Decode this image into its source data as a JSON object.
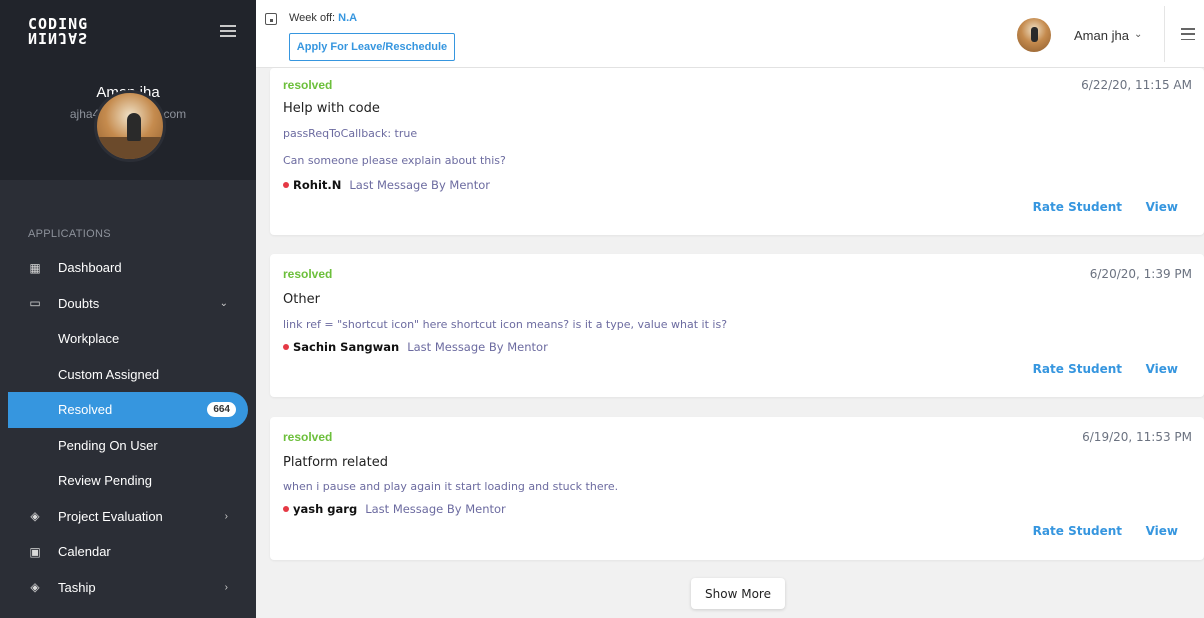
{
  "sidebar": {
    "logo_line1": "CODING",
    "logo_line2": "NINJAS",
    "user_name": "Aman jha",
    "user_email": "ajha4942@gmail.com",
    "section_label": "APPLICATIONS",
    "items": [
      {
        "label": "Dashboard",
        "icon": "dashboard-icon"
      },
      {
        "label": "Doubts",
        "icon": "doubts-icon"
      },
      {
        "label": "Workplace"
      },
      {
        "label": "Custom Assigned"
      },
      {
        "label": "Resolved",
        "badge": "664"
      },
      {
        "label": "Pending On User"
      },
      {
        "label": "Review Pending"
      },
      {
        "label": "Project Evaluation",
        "icon": "project-evaluation-icon"
      },
      {
        "label": "Calendar",
        "icon": "calendar-icon"
      },
      {
        "label": "Taship",
        "icon": "taship-icon"
      }
    ],
    "active_color": "#3696df"
  },
  "header": {
    "weekoff_label": "Week off:",
    "weekoff_value": "N.A",
    "leave_button": "Apply For Leave/Reschedule",
    "user_name": "Aman jha"
  },
  "cards": [
    {
      "status": "resolved",
      "time": "6/22/20, 11:15 AM",
      "title": "Help with code",
      "lines": [
        "passReqToCallback: true",
        "Can someone please explain about this?"
      ],
      "mentor": "Rohit.N",
      "last_message": "Last Message By Mentor",
      "rate": "Rate Student",
      "view": "View"
    },
    {
      "status": "resolved",
      "time": "6/20/20, 1:39 PM",
      "title": "Other",
      "lines": [
        "link ref = \"shortcut icon\" here shortcut icon means? is it a type, value what it is?"
      ],
      "mentor": "Sachin Sangwan",
      "last_message": "Last Message By Mentor",
      "rate": "Rate Student",
      "view": "View"
    },
    {
      "status": "resolved",
      "time": "6/19/20, 11:53 PM",
      "title": "Platform related",
      "lines": [
        "when i pause and play again it start loading and stuck there."
      ],
      "mentor": "yash garg",
      "last_message": "Last Message By Mentor",
      "rate": "Rate Student",
      "view": "View"
    }
  ],
  "show_more": "Show More",
  "colors": {
    "status": "#6cbf3b",
    "link": "#3696df",
    "dot": "#e53945"
  }
}
